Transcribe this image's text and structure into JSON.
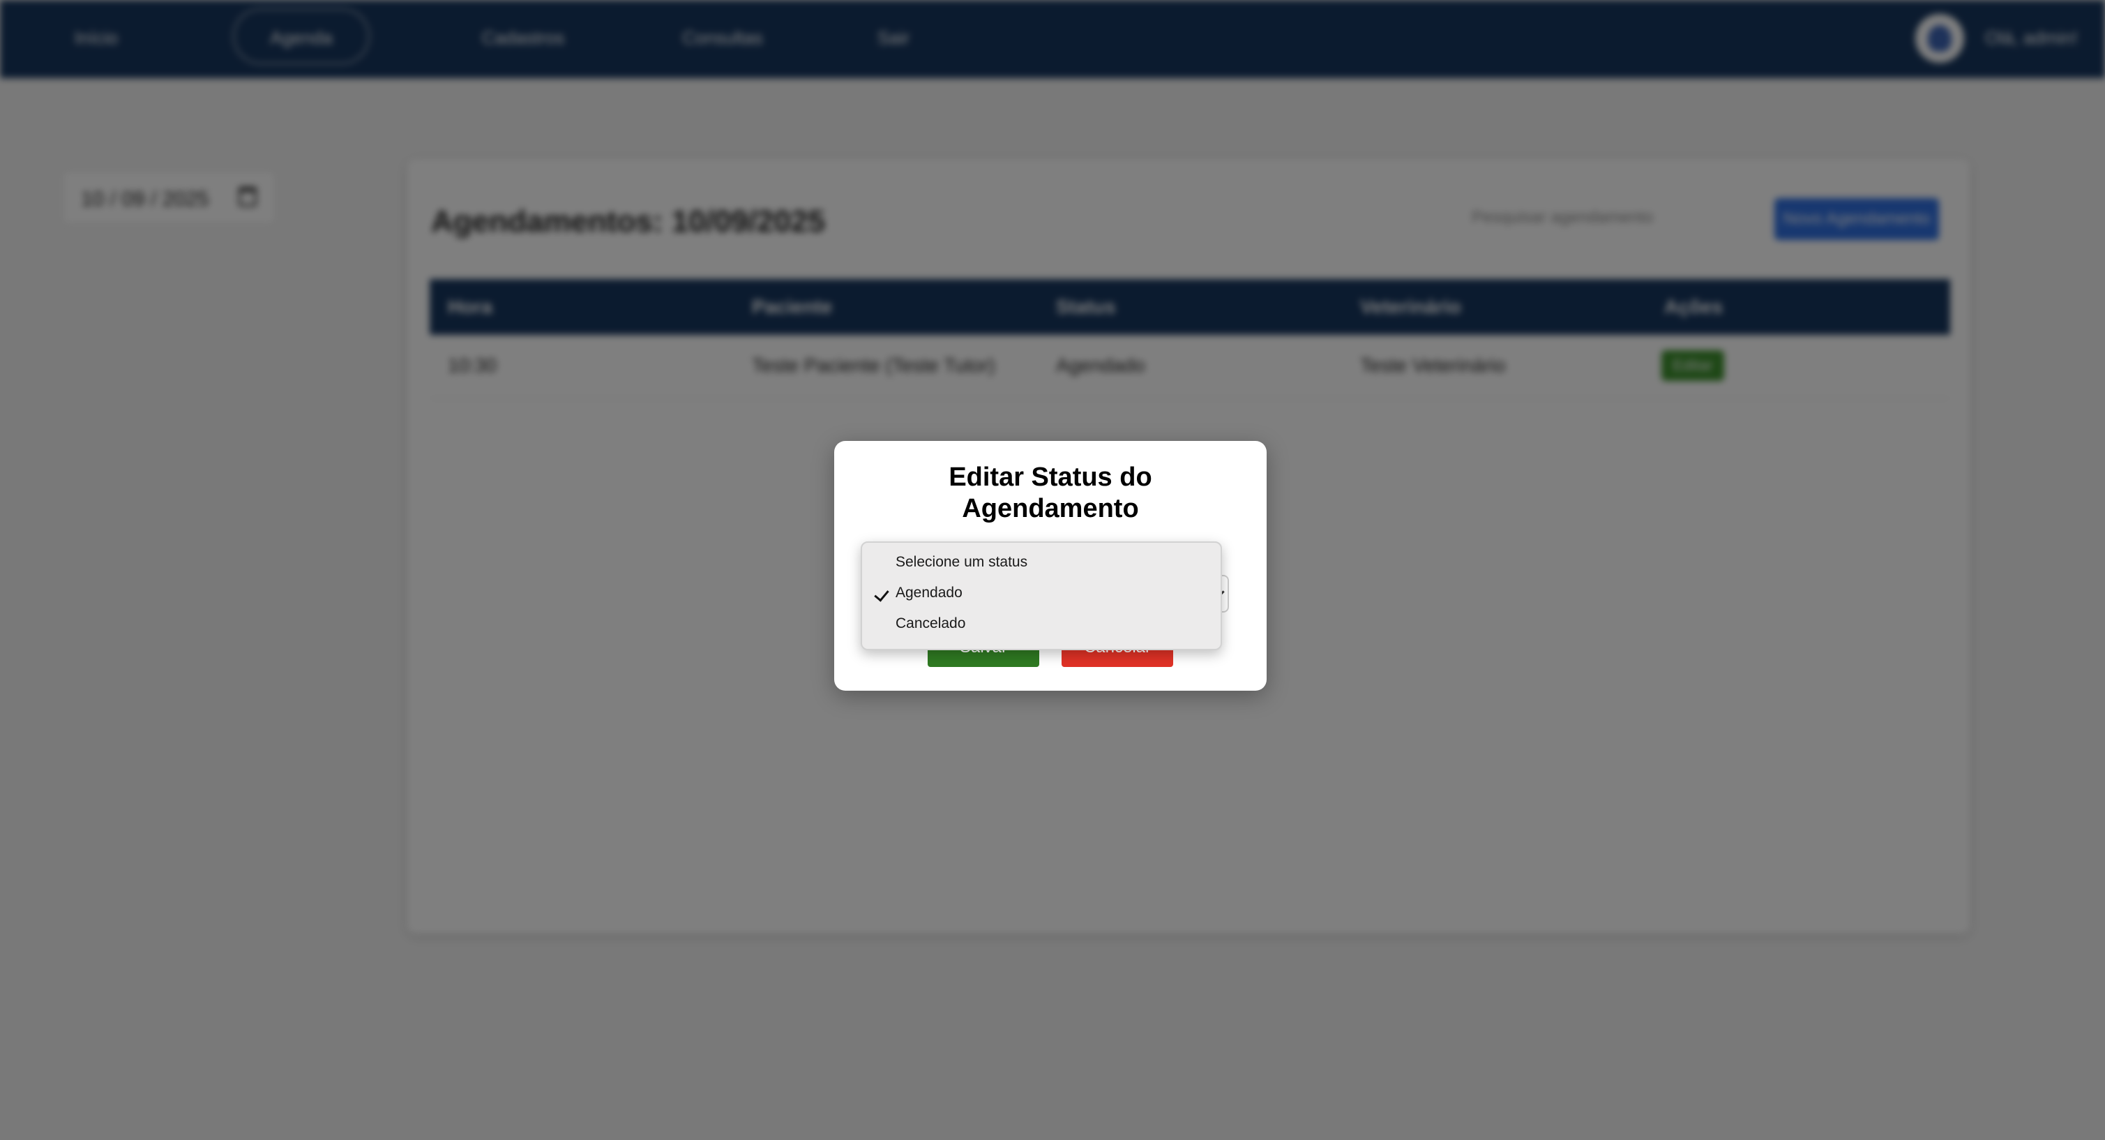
{
  "nav": {
    "items": [
      {
        "label": "Início"
      },
      {
        "label": "Agenda"
      },
      {
        "label": "Cadastros"
      },
      {
        "label": "Consultas"
      },
      {
        "label": "Sair"
      }
    ],
    "user": "Olá, admin!"
  },
  "sidebar": {
    "date": "10 / 09 / 2025"
  },
  "main": {
    "title": "Agendamentos: 10/09/2025",
    "search_placeholder": "Pesquisar agendamento",
    "new_button": "Novo Agendamento",
    "table": {
      "headers": [
        "Hora",
        "Paciente",
        "Status",
        "Veterinário",
        "Ações"
      ],
      "rows": [
        {
          "hora": "10:30",
          "paciente": "Teste Paciente (Teste Tutor)",
          "status": "Agendado",
          "veterinario": "Teste Veterinário",
          "acao": "Editar"
        }
      ]
    }
  },
  "modal": {
    "title_line1": "Editar Status do",
    "title_line2": "Agendamento",
    "save": "Salvar",
    "cancel": "Cancelar",
    "select_value": "Agendado",
    "options": [
      {
        "label": "Selecione um status",
        "checked": false
      },
      {
        "label": "Agendado",
        "checked": true
      },
      {
        "label": "Cancelado",
        "checked": false
      }
    ]
  },
  "colors": {
    "nav_bg": "#17365e",
    "save": "#2f7a22",
    "cancel": "#e03226",
    "primary": "#2f6fe0"
  },
  "icons": [
    "calendar-icon",
    "user-avatar-icon",
    "check-icon",
    "chevron-down-icon"
  ]
}
